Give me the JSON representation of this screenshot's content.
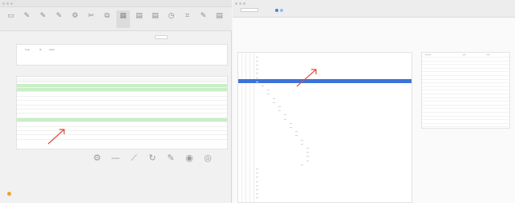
{
  "left_window": {
    "title": "",
    "toolbar": [
      {
        "icon": "screen-icon",
        "glyph": "▭",
        "label": ""
      },
      {
        "icon": "pencil-icon",
        "glyph": "✎",
        "label": ""
      },
      {
        "icon": "pencil-icon",
        "glyph": "✎",
        "label": ""
      },
      {
        "icon": "pencil-icon",
        "glyph": "✎",
        "label": ""
      },
      {
        "icon": "gear-icon",
        "glyph": "⚙",
        "label": ""
      },
      {
        "icon": "scissors-icon",
        "glyph": "✂",
        "label": ""
      },
      {
        "icon": "copy-icon",
        "glyph": "⧉",
        "label": ""
      },
      {
        "icon": "grid-icon",
        "glyph": "▦",
        "label": "",
        "selected": true
      },
      {
        "icon": "document-icon",
        "glyph": "▤",
        "label": ""
      },
      {
        "icon": "document-icon",
        "glyph": "▤",
        "label": ""
      },
      {
        "icon": "clock-icon",
        "glyph": "◷",
        "label": ""
      },
      {
        "icon": "crop-icon",
        "glyph": "⌗",
        "label": ""
      },
      {
        "icon": "pencil-icon",
        "glyph": "✎",
        "label": ""
      },
      {
        "icon": "document-icon",
        "glyph": "▤",
        "label": ""
      }
    ],
    "option_box": "",
    "device_panel": {
      "headers": [
        "Type",
        "ID",
        "Label"
      ],
      "row": [
        "",
        "",
        ""
      ]
    },
    "data_title": "",
    "data_table": {
      "headers": [
        "",
        "",
        "",
        "",
        "",
        "",
        "",
        ""
      ],
      "rows": [
        {
          "highlight": true,
          "cells": [
            "",
            "",
            "",
            "",
            "",
            "",
            "",
            ""
          ]
        },
        {
          "highlight": true,
          "cells": [
            "",
            "",
            "",
            "",
            "",
            "",
            "",
            ""
          ]
        },
        {
          "highlight": false,
          "cells": [
            "",
            "",
            "",
            "",
            "",
            "",
            "",
            ""
          ]
        },
        {
          "highlight": false,
          "cells": [
            "",
            "",
            "",
            "",
            "",
            "",
            "",
            ""
          ]
        },
        {
          "highlight": false,
          "cells": [
            "",
            "",
            "",
            "",
            "",
            "",
            "",
            ""
          ]
        },
        {
          "highlight": false,
          "cells": [
            "",
            "",
            "",
            "",
            "",
            "",
            "",
            ""
          ]
        },
        {
          "highlight": false,
          "cells": [
            "",
            "",
            "",
            "",
            "",
            "",
            "",
            ""
          ]
        },
        {
          "highlight": false,
          "cells": [
            "",
            "",
            "",
            "",
            "",
            "",
            "",
            ""
          ]
        },
        {
          "highlight": true,
          "cells": [
            "",
            "",
            "",
            "",
            "",
            "",
            "",
            ""
          ]
        },
        {
          "highlight": false,
          "cells": [
            "",
            "",
            "",
            "",
            "",
            "",
            "",
            ""
          ]
        },
        {
          "highlight": false,
          "cells": [
            "",
            "",
            "",
            "",
            "",
            "",
            "",
            ""
          ]
        },
        {
          "highlight": false,
          "cells": [
            "",
            "",
            "",
            "",
            "",
            "",
            "",
            ""
          ]
        },
        {
          "highlight": false,
          "cells": [
            "",
            "",
            "",
            "",
            "",
            "",
            "",
            ""
          ]
        }
      ]
    },
    "bottom_toolbar": [
      {
        "icon": "settings-icon",
        "glyph": "⚙"
      },
      {
        "icon": "minus-icon",
        "glyph": "—"
      },
      {
        "icon": "brush-icon",
        "glyph": "⟋"
      },
      {
        "icon": "refresh-icon",
        "glyph": "↻"
      },
      {
        "icon": "pencil-icon",
        "glyph": "✎"
      },
      {
        "icon": "stop-icon",
        "glyph": "◉"
      },
      {
        "icon": "target-icon",
        "glyph": "◎"
      }
    ],
    "footer_label": ""
  },
  "right_window": {
    "select_value": "",
    "page_counter": "",
    "url": "",
    "section_title": "",
    "breadcrumb": "",
    "result_label": "",
    "result_text": "",
    "tree_rows": [
      {
        "text": "",
        "indent": 0
      },
      {
        "text": "",
        "indent": 0
      },
      {
        "text": "",
        "indent": 0
      },
      {
        "text": "",
        "indent": 0
      },
      {
        "text": "",
        "indent": 0
      },
      {
        "text": "",
        "indent": 0
      },
      {
        "text": "",
        "indent": 0,
        "selected": true
      },
      {
        "text": "",
        "indent": 1
      },
      {
        "text": "",
        "indent": 2
      },
      {
        "text": "",
        "indent": 2
      },
      {
        "text": "",
        "indent": 3
      },
      {
        "text": "",
        "indent": 3
      },
      {
        "text": "",
        "indent": 4
      },
      {
        "text": "",
        "indent": 4
      },
      {
        "text": "",
        "indent": 5
      },
      {
        "text": "",
        "indent": 5
      },
      {
        "text": "",
        "indent": 6
      },
      {
        "text": "",
        "indent": 6
      },
      {
        "text": "",
        "indent": 7
      },
      {
        "text": "",
        "indent": 7
      },
      {
        "text": "",
        "indent": 8
      },
      {
        "text": "",
        "indent": 8
      },
      {
        "text": "",
        "indent": 9
      },
      {
        "text": "",
        "indent": 9
      },
      {
        "text": "",
        "indent": 9
      },
      {
        "text": "",
        "indent": 9
      },
      {
        "text": "",
        "indent": 8
      },
      {
        "text": "",
        "indent": 0
      },
      {
        "text": "",
        "indent": 0
      },
      {
        "text": "",
        "indent": 0
      },
      {
        "text": "",
        "indent": 0
      },
      {
        "text": "",
        "indent": 0
      },
      {
        "text": "",
        "indent": 0
      },
      {
        "text": "",
        "indent": 0
      },
      {
        "text": "",
        "indent": 0
      }
    ],
    "properties": {
      "headers": [
        "Property",
        "Type",
        "Value"
      ],
      "rows": [
        [
          "",
          "",
          ""
        ],
        [
          "",
          "",
          ""
        ],
        [
          "",
          "",
          ""
        ],
        [
          "",
          "",
          ""
        ],
        [
          "",
          "",
          ""
        ],
        [
          "",
          "",
          ""
        ],
        [
          "",
          "",
          ""
        ],
        [
          "",
          "",
          ""
        ],
        [
          "",
          "",
          ""
        ],
        [
          "",
          "",
          ""
        ],
        [
          "",
          "",
          ""
        ],
        [
          "",
          "",
          ""
        ],
        [
          "",
          "",
          ""
        ],
        [
          "",
          "",
          ""
        ],
        [
          "",
          "",
          ""
        ],
        [
          "",
          "",
          ""
        ],
        [
          "",
          "",
          ""
        ],
        [
          "",
          "",
          ""
        ],
        [
          "",
          "",
          ""
        ]
      ]
    }
  },
  "colors": {
    "accent": "#3d73d9",
    "highlight_row": "#c9efc6",
    "annotation_arrow": "#e24b3b",
    "warning": "#f2a02b"
  }
}
